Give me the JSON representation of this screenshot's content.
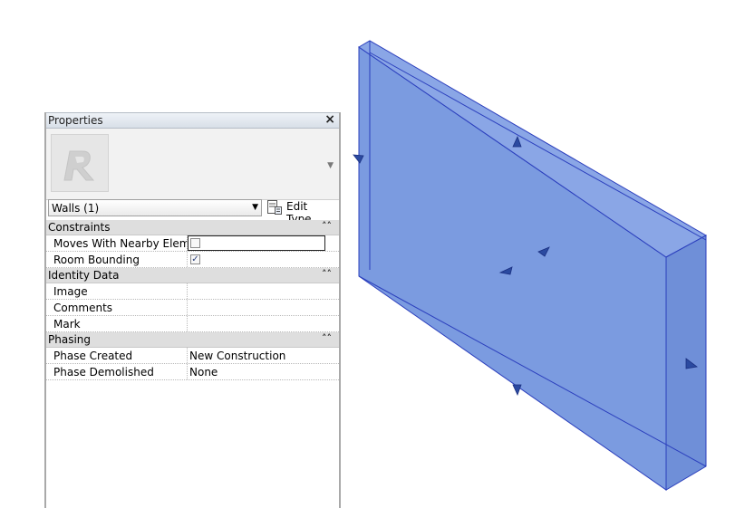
{
  "properties": {
    "title": "Properties",
    "type_selector": {
      "value": "Walls (1)"
    },
    "edit_type_label": "Edit Type",
    "groups": [
      {
        "label": "Constraints",
        "rows": [
          {
            "name": "Moves With Nearby Elem...",
            "value_type": "checkbox",
            "checked": false
          },
          {
            "name": "Room Bounding",
            "value_type": "checkbox",
            "checked": true
          }
        ]
      },
      {
        "label": "Identity Data",
        "rows": [
          {
            "name": "Image",
            "value": ""
          },
          {
            "name": "Comments",
            "value": ""
          },
          {
            "name": "Mark",
            "value": ""
          }
        ]
      },
      {
        "label": "Phasing",
        "rows": [
          {
            "name": "Phase Created",
            "value": "New Construction"
          },
          {
            "name": "Phase Demolished",
            "value": "None"
          }
        ]
      }
    ]
  },
  "colors": {
    "wall_fill": "#7b9be0",
    "wall_edge": "#2b3fbd",
    "grip": "#2b4aa0"
  }
}
